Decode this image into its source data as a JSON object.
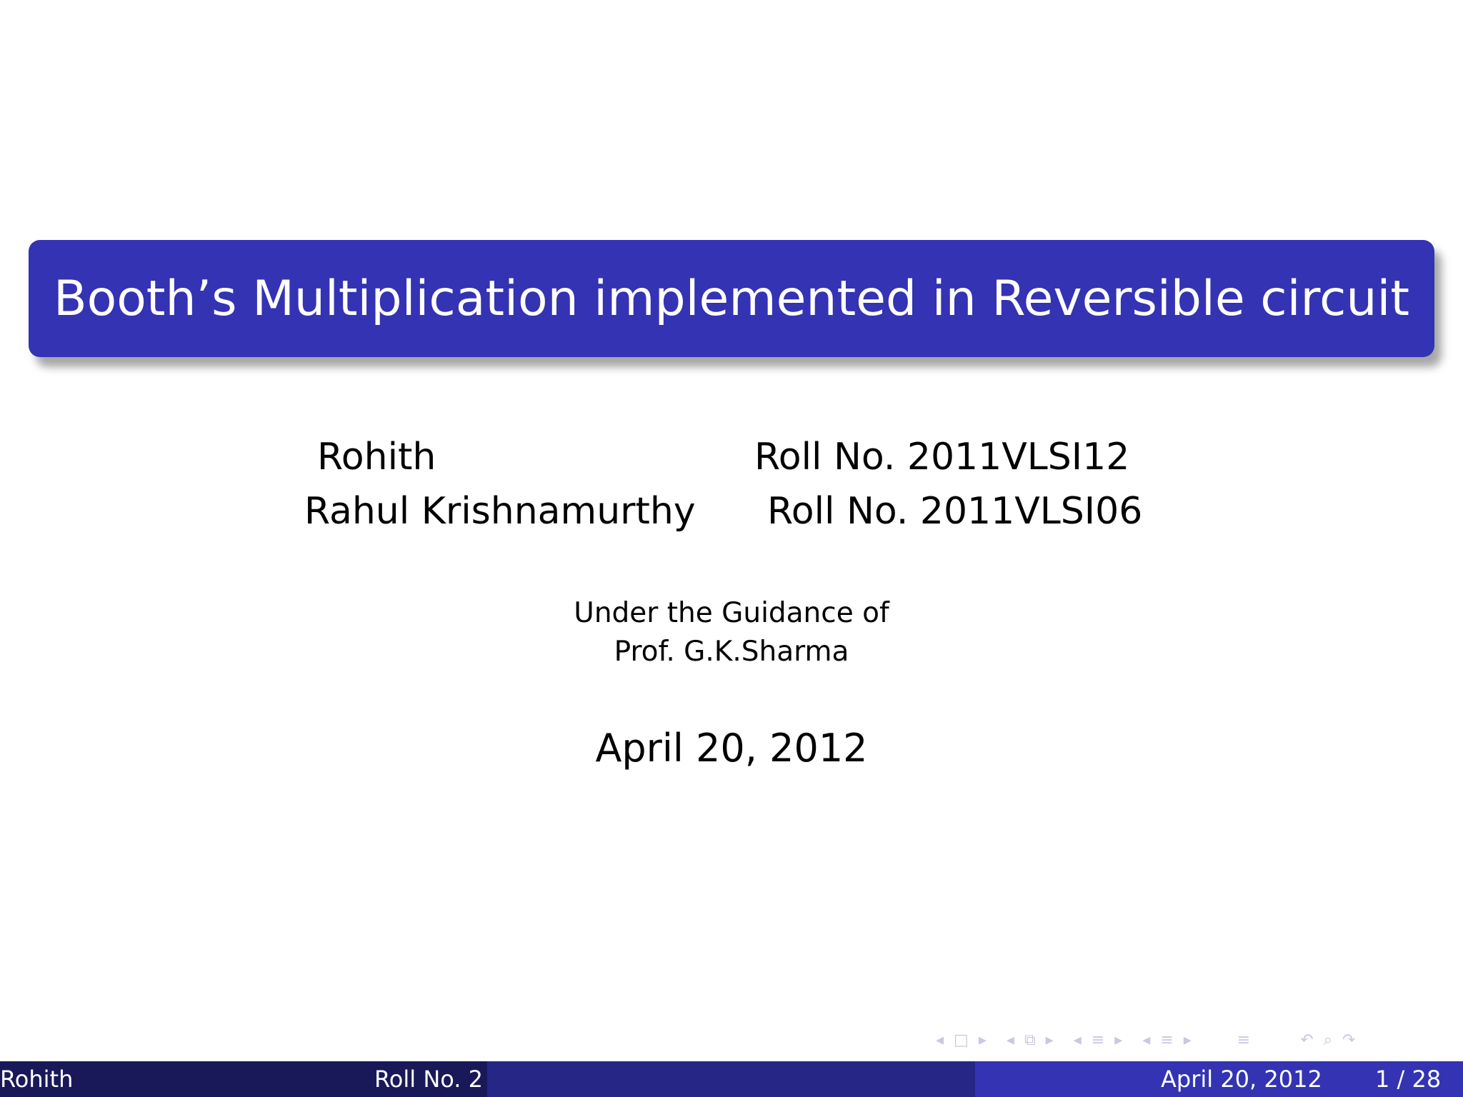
{
  "slide": {
    "title": "Booth’s Multiplication implemented in Reversible circuit",
    "authors": [
      {
        "name": "Rohith",
        "roll": "Roll No. 2011VLSI12"
      },
      {
        "name": "Rahul Krishnamurthy",
        "roll": "Roll No. 2011VLSI06"
      }
    ],
    "guidance_line1": "Under the Guidance of",
    "guidance_line2": "Prof. G.K.Sharma",
    "date": "April 20, 2012"
  },
  "navigation": {
    "icons": [
      "nav-left-arrow",
      "frame-icon",
      "nav-right-arrow",
      "nav-left-arrow",
      "subsection-icon",
      "nav-right-arrow",
      "nav-left-arrow",
      "section-icon",
      "nav-right-arrow",
      "nav-left-arrow",
      "section-icon",
      "nav-right-arrow",
      "align-icon",
      "search-icon",
      "back-icon"
    ]
  },
  "footer": {
    "author_short": "Rohith",
    "roll_short": "Roll No. 2",
    "date": "April 20, 2012",
    "page": "1 / 28"
  },
  "colors": {
    "title_bg": "#3333b3",
    "footer_dark": "#191959",
    "footer_mid": "#262686",
    "footer_light": "#3333b3"
  }
}
